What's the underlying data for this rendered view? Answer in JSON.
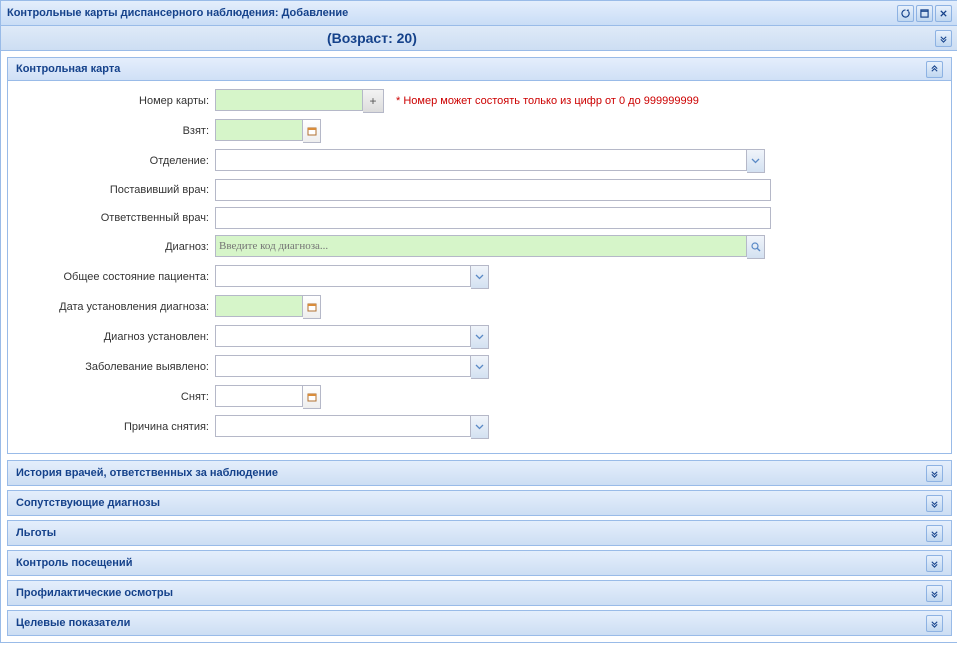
{
  "window": {
    "title": "Контрольные карты диспансерного наблюдения: Добавление"
  },
  "subbar": {
    "text": "(Возраст: 20)"
  },
  "mainPanel": {
    "title": "Контрольная карта"
  },
  "form": {
    "cardNumber": {
      "label": "Номер карты:",
      "value": "",
      "hint": "* Номер может состоять только из цифр от 0 до 999999999"
    },
    "taken": {
      "label": "Взят:",
      "value": ""
    },
    "department": {
      "label": "Отделение:",
      "value": ""
    },
    "assigningDoctor": {
      "label": "Поставивший врач:",
      "value": ""
    },
    "responsibleDoctor": {
      "label": "Ответственный врач:",
      "value": ""
    },
    "diagnosis": {
      "label": "Диагноз:",
      "placeholder": "Введите код диагноза...",
      "value": ""
    },
    "patientCondition": {
      "label": "Общее состояние пациента:",
      "value": ""
    },
    "diagnosisDate": {
      "label": "Дата установления диагноза:",
      "value": ""
    },
    "diagnosisSet": {
      "label": "Диагноз установлен:",
      "value": ""
    },
    "diseaseFound": {
      "label": "Заболевание выявлено:",
      "value": ""
    },
    "removed": {
      "label": "Снят:",
      "value": ""
    },
    "removalReason": {
      "label": "Причина снятия:",
      "value": ""
    }
  },
  "collapsedPanels": [
    "История врачей, ответственных за наблюдение",
    "Сопутствующие диагнозы",
    "Льготы",
    "Контроль посещений",
    "Профилактические осмотры",
    "Целевые показатели"
  ]
}
